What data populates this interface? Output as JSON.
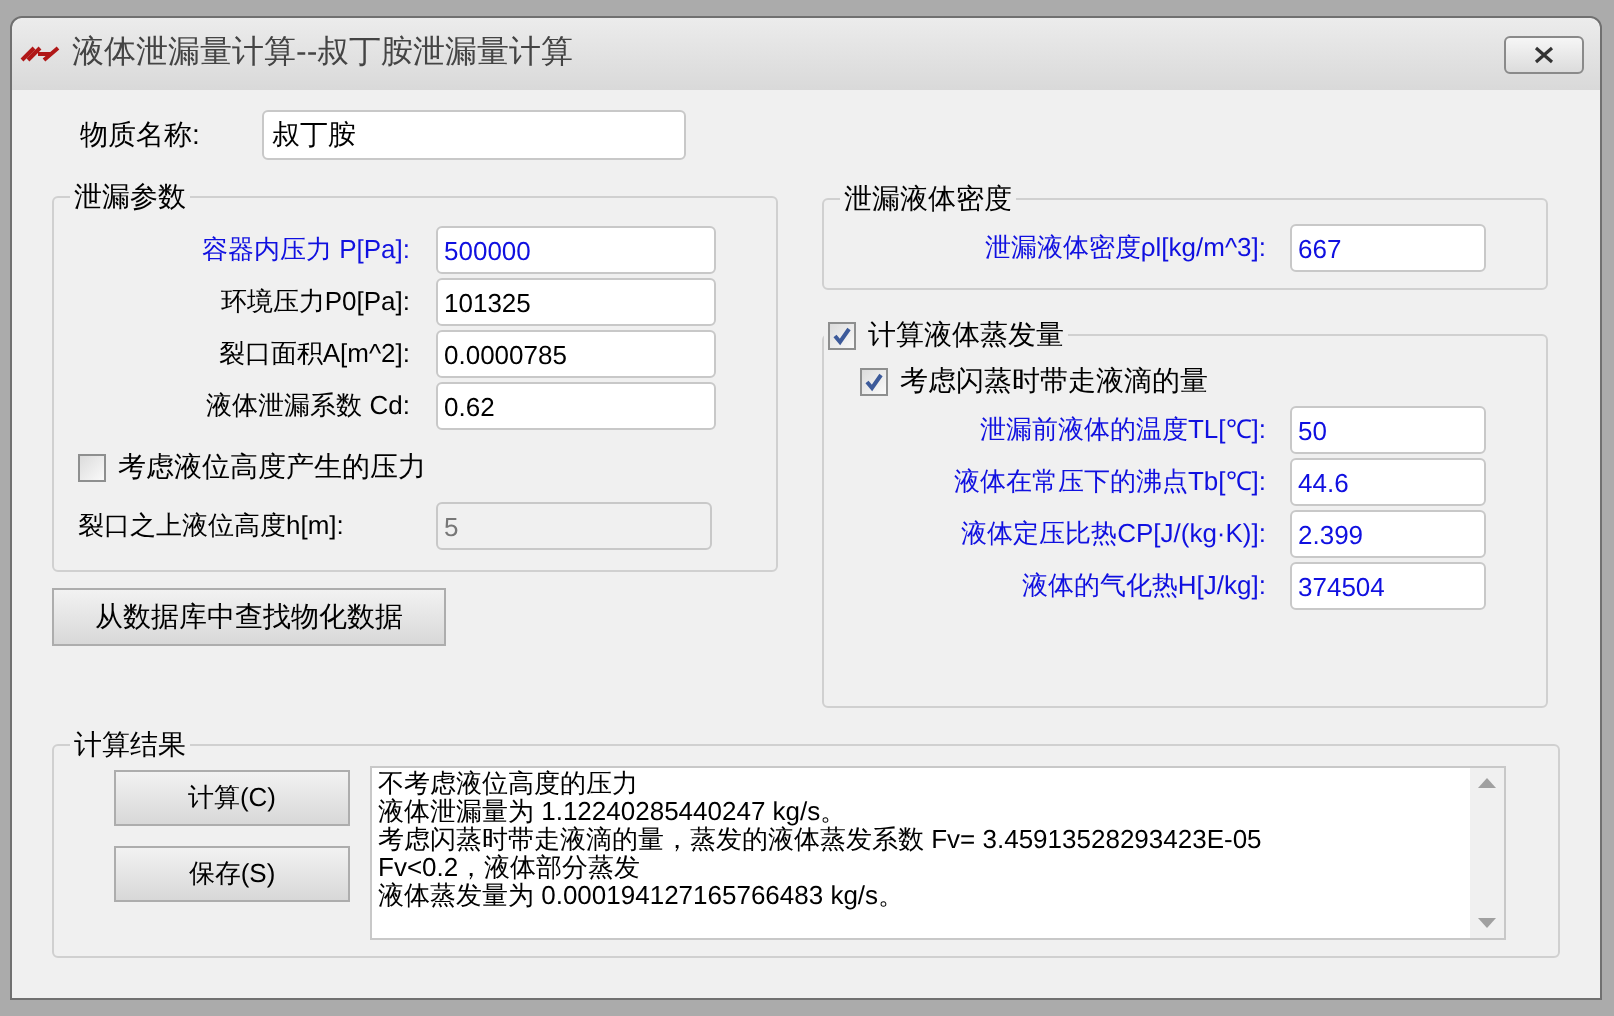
{
  "window": {
    "title": "液体泄漏量计算--叔丁胺泄漏量计算"
  },
  "substance": {
    "label": "物质名称:",
    "value": "叔丁胺"
  },
  "leak_params": {
    "title": "泄漏参数",
    "fields": [
      {
        "label": "容器内压力 P[Pa]:",
        "value": "500000",
        "emphasized": true
      },
      {
        "label": "环境压力P0[Pa]:",
        "value": "101325",
        "emphasized": false
      },
      {
        "label": "裂口面积A[m^2]:",
        "value": "0.0000785",
        "emphasized": false
      },
      {
        "label": "液体泄漏系数  Cd:",
        "value": "0.62",
        "emphasized": false
      }
    ],
    "level_checkbox": {
      "label": "考虑液位高度产生的压力",
      "checked": false
    },
    "height_field": {
      "label": "裂口之上液位高度h[m]:",
      "value": "5",
      "disabled": true
    }
  },
  "lookup_button": "从数据库中查找物化数据",
  "density": {
    "title": "泄漏液体密度",
    "fields": [
      {
        "label": "泄漏液体密度ρl[kg/m^3]:",
        "value": "667",
        "emphasized": true
      }
    ]
  },
  "evaporation": {
    "title": "计算液体蒸发量",
    "checked": true,
    "flash_checkbox": {
      "label": "考虑闪蒸时带走液滴的量",
      "checked": true
    },
    "fields": [
      {
        "label": "泄漏前液体的温度TL[℃]:",
        "value": "50",
        "emphasized": true
      },
      {
        "label": "液体在常压下的沸点Tb[℃]:",
        "value": "44.6",
        "emphasized": true
      },
      {
        "label": "液体定压比热CP[J/(kg·K)]:",
        "value": "2.399",
        "emphasized": true
      },
      {
        "label": "液体的气化热H[J/kg]:",
        "value": "374504",
        "emphasized": true
      }
    ]
  },
  "results": {
    "title": "计算结果",
    "buttons": [
      "计算(C)",
      "保存(S)"
    ],
    "lines": [
      "不考虑液位高度的压力",
      "液体泄漏量为 1.12240285440247 kg/s。",
      "考虑闪蒸时带走液滴的量，蒸发的液体蒸发系数 Fv= 3.45913528293423E-05",
      "Fv<0.2，液体部分蒸发",
      "液体蒸发量为 0.000194127165766483 kg/s。"
    ]
  }
}
